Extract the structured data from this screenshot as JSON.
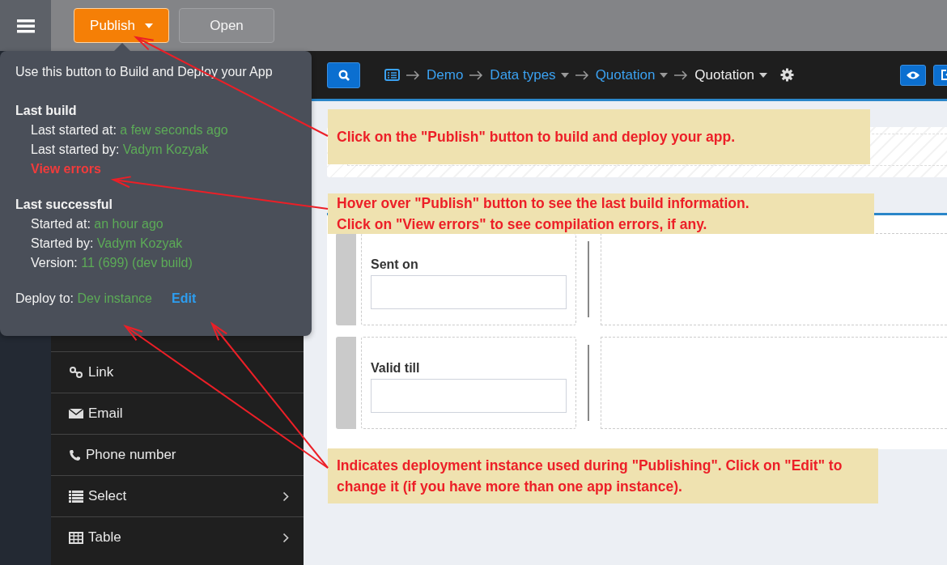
{
  "toolbar": {
    "buttons": [
      {
        "label": "Publish",
        "kind": "primary",
        "dropdown": true
      },
      {
        "label": "Open",
        "kind": "secondary",
        "dropdown": false
      }
    ]
  },
  "popover": {
    "intro": "Use this button to Build and Deploy your App",
    "sections": [
      {
        "title": "Last build",
        "rows": [
          {
            "label": "Last started at:",
            "value": "a few seconds ago"
          },
          {
            "label": "Last started by:",
            "value": "Vadym Kozyak"
          }
        ],
        "link": "View errors"
      },
      {
        "title": "Last successful",
        "rows": [
          {
            "label": "Started at:",
            "value": "an hour ago"
          },
          {
            "label": "Started by:",
            "value": "Vadym Kozyak"
          },
          {
            "label": "Version:",
            "value": "11 (699) (dev build)"
          }
        ]
      }
    ],
    "deploy": {
      "label": "Deploy to:",
      "value": "Dev instance",
      "action": "Edit"
    }
  },
  "sidebar": {
    "items": [
      {
        "label": "Link",
        "kind": "link",
        "expandable": false
      },
      {
        "label": "Email",
        "kind": "email",
        "expandable": false
      },
      {
        "label": "Phone number",
        "kind": "phone",
        "expandable": false
      },
      {
        "label": "Select",
        "kind": "select",
        "expandable": true
      },
      {
        "label": "Table",
        "kind": "table",
        "expandable": true
      }
    ]
  },
  "header": {
    "breadcrumb": [
      {
        "label": "Demo",
        "current": false,
        "dropdown": false
      },
      {
        "label": "Data types",
        "current": false,
        "dropdown": true
      },
      {
        "label": "Quotation",
        "current": false,
        "dropdown": true
      },
      {
        "label": "Quotation",
        "current": true,
        "dropdown": true
      }
    ]
  },
  "form": {
    "fields": [
      {
        "label": "Sent on"
      },
      {
        "label": "Valid till"
      }
    ]
  },
  "annotations": [
    {
      "text": "Click on the \"Publish\" button to build and deploy your app."
    },
    {
      "text": "Hover over \"Publish\" button to see the last build information. Click on \"View errors\" to see compilation errors, if any."
    },
    {
      "text": "Indicates deployment instance used during \"Publishing\". Click on \"Edit\" to change it (if you have more than one app instance)."
    }
  ]
}
